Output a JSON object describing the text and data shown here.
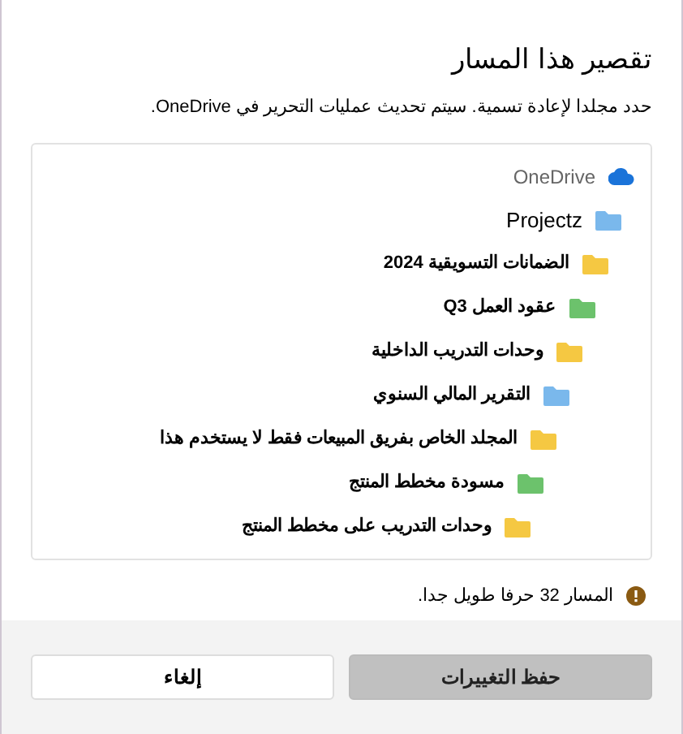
{
  "dialog": {
    "title": "تقصير هذا المسار",
    "description": "حدد مجلدا لإعادة تسمية. سيتم تحديث عمليات التحرير في OneDrive."
  },
  "tree": {
    "root": {
      "label": "OneDrive",
      "kind": "cloud",
      "children": [
        {
          "label": "Projectz",
          "kind": "folder",
          "color": "#7ab8ec",
          "children": [
            {
              "label": "الضمانات التسويقية 2024",
              "kind": "folder",
              "color": "#f5c842",
              "children": [
                {
                  "label": "عقود العمل Q3",
                  "kind": "folder",
                  "color": "#6cc26c",
                  "children": [
                    {
                      "label": "وحدات التدريب الداخلية",
                      "kind": "folder",
                      "color": "#f5c842",
                      "children": [
                        {
                          "label": "التقرير المالي السنوي",
                          "kind": "folder",
                          "color": "#7ab8ec",
                          "children": [
                            {
                              "label": "المجلد الخاص بفريق المبيعات فقط لا يستخدم هذا",
                              "kind": "folder",
                              "color": "#f5c842",
                              "children": [
                                {
                                  "label": "مسودة مخطط المنتج",
                                  "kind": "folder",
                                  "color": "#6cc26c",
                                  "children": [
                                    {
                                      "label": "وحدات التدريب على مخطط المنتج",
                                      "kind": "folder",
                                      "color": "#f5c842"
                                    }
                                  ]
                                }
                              ]
                            }
                          ]
                        }
                      ]
                    }
                  ]
                }
              ]
            }
          ]
        }
      ]
    }
  },
  "warning": {
    "text": "المسار 32 حرفا طويل جدا."
  },
  "buttons": [
    {
      "label": "حفظ التغييرات",
      "kind": "primary",
      "disabled": true
    },
    {
      "label": "إلغاء",
      "kind": "secondary",
      "disabled": false
    }
  ]
}
